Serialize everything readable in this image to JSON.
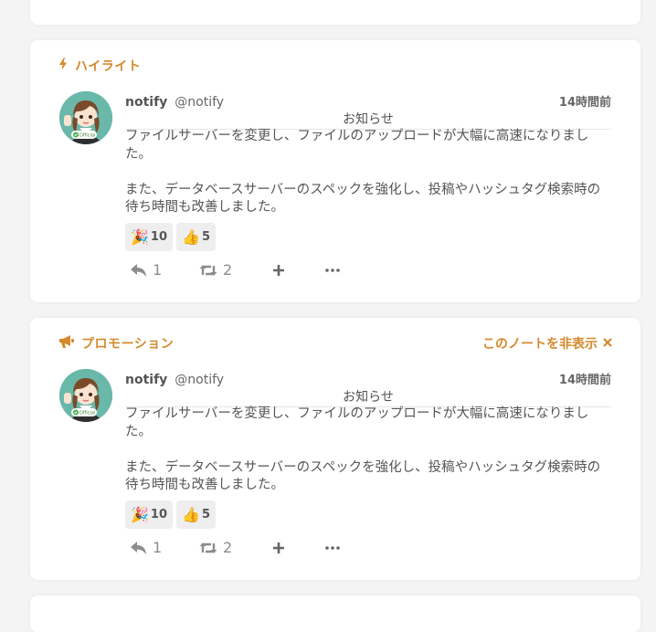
{
  "notes": [
    {
      "header_label": "ハイライト",
      "header_icon": "bolt-icon",
      "hide_label": "",
      "author_name": "notify",
      "author_username": "@notify",
      "time": "14時間前",
      "cw": "お知らせ",
      "text": "ファイルサーバーを変更し、ファイルのアップロードが大幅に高速になりました。\n\nまた、データベースサーバーのスペックを強化し、投稿やハッシュタグ検索時の待ち時間も改善しました。",
      "reactions": [
        {
          "emoji": "🎉",
          "count": "10"
        },
        {
          "emoji": "👍",
          "count": "5"
        }
      ],
      "reply_count": "1",
      "renote_count": "2",
      "avatar_badge": "Official"
    },
    {
      "header_label": "プロモーション",
      "header_icon": "megaphone-icon",
      "hide_label": "このノートを非表示",
      "author_name": "notify",
      "author_username": "@notify",
      "time": "14時間前",
      "cw": "お知らせ",
      "text": "ファイルサーバーを変更し、ファイルのアップロードが大幅に高速になりました。\n\nまた、データベースサーバーのスペックを強化し、投稿やハッシュタグ検索時の待ち時間も改善しました。",
      "reactions": [
        {
          "emoji": "🎉",
          "count": "10"
        },
        {
          "emoji": "👍",
          "count": "5"
        }
      ],
      "reply_count": "1",
      "renote_count": "2",
      "avatar_badge": "Official"
    }
  ],
  "colors": {
    "accent": "#d48a2c",
    "card_bg": "#ffffff",
    "page_bg": "#f4f4f5",
    "text": "#555555",
    "muted": "#8c8c8c"
  }
}
